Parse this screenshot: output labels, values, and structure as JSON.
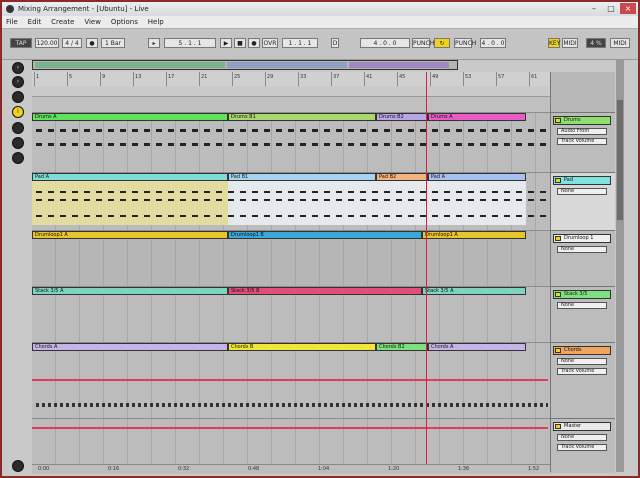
{
  "window": {
    "title": "Mixing Arrangement - [Ubuntu] - Live",
    "buttons": [
      "–",
      "□",
      "×"
    ]
  },
  "menu": [
    "File",
    "Edit",
    "Create",
    "View",
    "Options",
    "Help"
  ],
  "toolbar": {
    "tap": "TAP",
    "tempo": "120.00",
    "time_sig": "4 / 4",
    "metro": "●",
    "quant": "1 Bar",
    "follow": "▸",
    "position": "5 . 1 . 1",
    "transport": [
      "▶",
      "■",
      "●"
    ],
    "overdub": "OVR",
    "loop_start": "1 . 1 . 1",
    "punch": "PUNCH",
    "loop": "↻",
    "loop_len": "4 . 0 . 0",
    "key": "KEY",
    "midi": "MIDI",
    "cpu": "4 %",
    "draw": "D"
  },
  "icons": {
    "app": "live-logo-icon",
    "left": [
      "arrow-icon",
      "arrow-icon",
      "circle-icon",
      "info-icon",
      "circle-icon",
      "circle-icon",
      "circle-icon",
      "circle-icon"
    ]
  },
  "ruler": {
    "bars": [
      "1",
      "5",
      "9",
      "13",
      "17",
      "21",
      "25",
      "29",
      "33",
      "37",
      "41",
      "45",
      "49",
      "53",
      "57",
      "61"
    ]
  },
  "timeline": {
    "times": [
      "0:00",
      "0:16",
      "0:32",
      "0:48",
      "1:04",
      "1:20",
      "1:36",
      "1:52"
    ]
  },
  "tracks": [
    {
      "name": "Drums",
      "color": "#8ee06e",
      "io": [
        "Audio From",
        "Track Volume"
      ],
      "clips": [
        {
          "label": "Drums A",
          "color": "#5ee35a"
        },
        {
          "label": "Drums B1",
          "color": "#a9d871"
        },
        {
          "label": "Drums B2",
          "color": "#b7a6e6"
        },
        {
          "label": "Drums A",
          "color": "#e85cc8"
        }
      ]
    },
    {
      "name": "Pad",
      "color": "#7fe3e0",
      "io": [
        "None"
      ],
      "clips": [
        {
          "label": "Pad A",
          "color": "#7fdcd7"
        },
        {
          "label": "Pad B1",
          "color": "#a8d3f0"
        },
        {
          "label": "Pad B2",
          "color": "#f4b27c"
        },
        {
          "label": "Pad A",
          "color": "#a8c0f0"
        }
      ]
    },
    {
      "name": "Drumloop 1",
      "color": "#f0f0f0",
      "io": [
        "None"
      ],
      "clips": [
        {
          "label": "Drumloop1 A",
          "color": "#e8c52b"
        },
        {
          "label": "Drumloop1 B",
          "color": "#3aa8d8"
        },
        {
          "label": "Drumloop1 A",
          "color": "#e8c52b"
        }
      ]
    },
    {
      "name": "Stack 3/5",
      "color": "#7fe07f",
      "io": [
        "None"
      ],
      "clips": [
        {
          "label": "Stack 3/5 A",
          "color": "#7fd4c0"
        },
        {
          "label": "Stack 3/5 B",
          "color": "#e24d7a"
        },
        {
          "label": "Stack 3/5 A",
          "color": "#7fd4c0"
        }
      ]
    },
    {
      "name": "Chords",
      "color": "#f0a460",
      "io": [
        "None",
        "Track Volume"
      ],
      "clips": [
        {
          "label": "Chords A",
          "color": "#c6b4e8"
        },
        {
          "label": "Chords B",
          "color": "#f2e63a"
        },
        {
          "label": "Chords B2",
          "color": "#7fe07f"
        },
        {
          "label": "Chords A",
          "color": "#c6b4e8"
        }
      ]
    },
    {
      "name": "Master",
      "color": "#e9e9e9",
      "io": [
        "None",
        "Track Volume"
      ],
      "clips": []
    }
  ]
}
